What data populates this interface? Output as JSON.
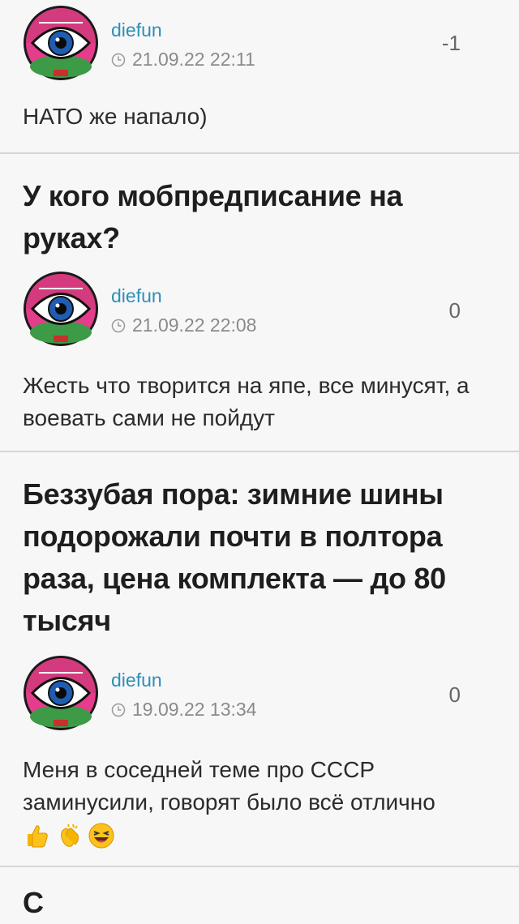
{
  "posts": [
    {
      "title": "",
      "author": "diefun",
      "date": "21.09.22 22:11",
      "score": "-1",
      "text": "НАТО же напало)"
    },
    {
      "title": "У кого мобпредписание на руках?",
      "author": "diefun",
      "date": "21.09.22 22:08",
      "score": "0",
      "text": "Жесть что творится на япе, все минусят, а воевать сами не пойдут"
    },
    {
      "title": "Беззубая пора: зимние шины подорожали почти в полтора раза, цена комплекта — до 80 тысяч",
      "author": "diefun",
      "date": "19.09.22 13:34",
      "score": "0",
      "text": "Меня в соседней теме про СССР заминусили, говорят было всё отлично",
      "emojis": [
        "thumbs-up-icon",
        "clapping-hands-icon",
        "laughing-face-icon"
      ]
    }
  ],
  "partial_next_title": "С"
}
